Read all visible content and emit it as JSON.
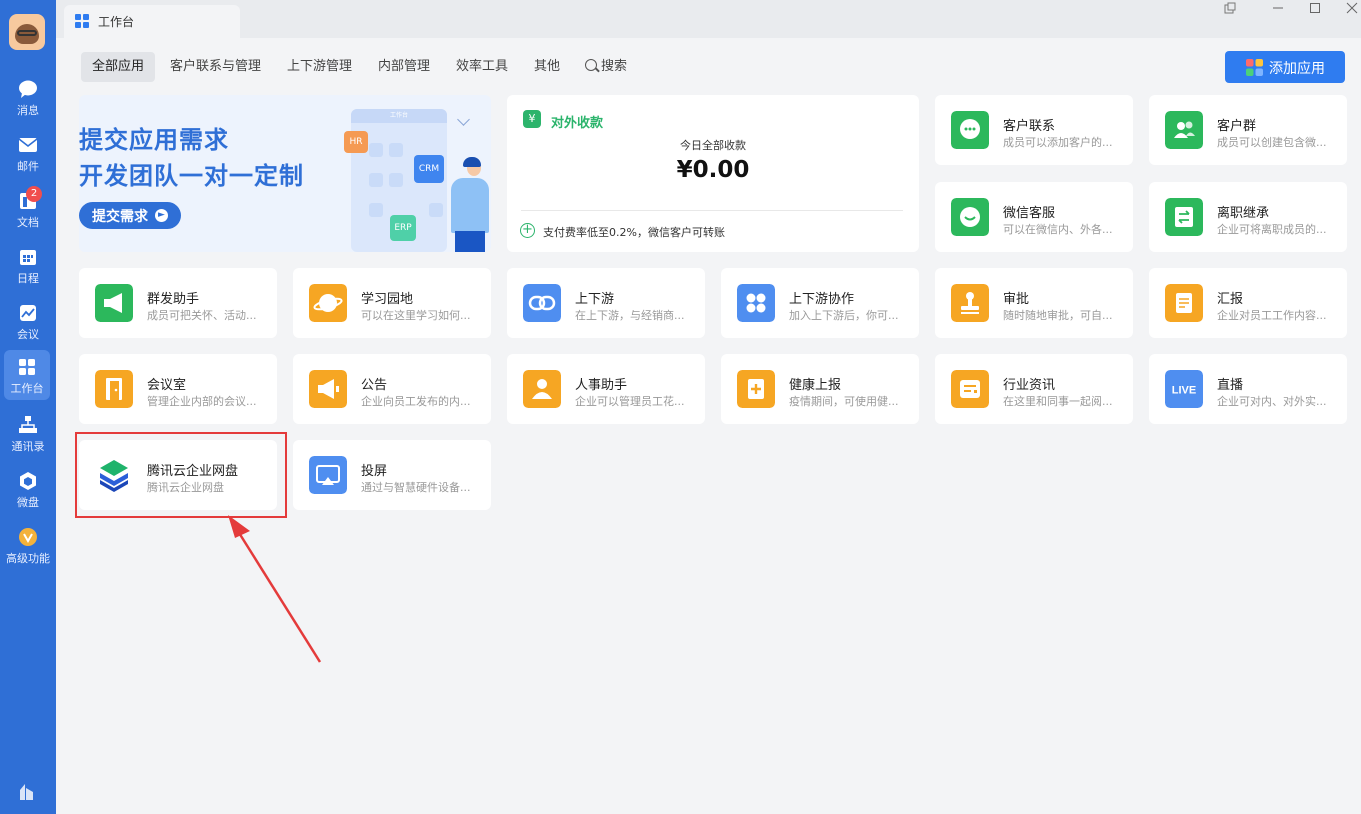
{
  "sidebar": {
    "items": [
      {
        "label": "消息",
        "icon": "message-icon"
      },
      {
        "label": "邮件",
        "icon": "mail-icon"
      },
      {
        "label": "文档",
        "icon": "document-icon",
        "badge": "2"
      },
      {
        "label": "日程",
        "icon": "calendar-icon"
      },
      {
        "label": "会议",
        "icon": "meeting-icon"
      },
      {
        "label": "工作台",
        "icon": "workbench-icon",
        "active": true
      },
      {
        "label": "通讯录",
        "icon": "contacts-icon"
      },
      {
        "label": "微盘",
        "icon": "weipan-icon"
      },
      {
        "label": "高级功能",
        "icon": "premium-icon"
      }
    ]
  },
  "window": {
    "tab_title": "工作台"
  },
  "categories": [
    "全部应用",
    "客户联系与管理",
    "上下游管理",
    "内部管理",
    "效率工具",
    "其他",
    "搜索"
  ],
  "add_app_label": "添加应用",
  "banner": {
    "line1": "提交应用需求",
    "line2": "开发团队一对一定制",
    "button": "提交需求",
    "chips": [
      "HR",
      "CRM",
      "ERP"
    ],
    "board_title": "工作台"
  },
  "income": {
    "title": "对外收款",
    "subtitle": "今日全部收款",
    "amount": "¥0.00",
    "note": "支付费率低至0.2%，微信客户可转账"
  },
  "apps": [
    {
      "name": "客户联系",
      "desc": "成员可以添加客户的...",
      "icon": "chat-bubble-icon",
      "color": "#2cb85c"
    },
    {
      "name": "客户群",
      "desc": "成员可以创建包含微...",
      "icon": "group-icon",
      "color": "#2cb85c"
    },
    {
      "name": "微信客服",
      "desc": "可以在微信内、外各...",
      "icon": "customer-service-icon",
      "color": "#2cb85c"
    },
    {
      "name": "离职继承",
      "desc": "企业可将离职成员的...",
      "icon": "transfer-icon",
      "color": "#2cb85c"
    },
    {
      "name": "群发助手",
      "desc": "成员可把关怀、活动...",
      "icon": "megaphone-icon",
      "color": "#2cb85c"
    },
    {
      "name": "学习园地",
      "desc": "可以在这里学习如何...",
      "icon": "planet-icon",
      "color": "#f6a623"
    },
    {
      "name": "上下游",
      "desc": "在上下游，与经销商...",
      "icon": "link-icon",
      "color": "#4f8ef0"
    },
    {
      "name": "上下游协作",
      "desc": "加入上下游后，你可...",
      "icon": "collab-icon",
      "color": "#4f8ef0"
    },
    {
      "name": "审批",
      "desc": "随时随地审批，可自...",
      "icon": "stamp-icon",
      "color": "#f6a623"
    },
    {
      "name": "汇报",
      "desc": "企业对员工工作内容...",
      "icon": "report-icon",
      "color": "#f6a623"
    },
    {
      "name": "会议室",
      "desc": "管理企业内部的会议...",
      "icon": "door-icon",
      "color": "#f6a623"
    },
    {
      "name": "公告",
      "desc": "企业向员工发布的内...",
      "icon": "announcement-icon",
      "color": "#f6a623"
    },
    {
      "name": "人事助手",
      "desc": "企业可以管理员工花...",
      "icon": "hr-person-icon",
      "color": "#f6a623"
    },
    {
      "name": "健康上报",
      "desc": "疫情期间，可使用健...",
      "icon": "health-icon",
      "color": "#f6a623"
    },
    {
      "name": "行业资讯",
      "desc": "在这里和同事一起阅...",
      "icon": "news-icon",
      "color": "#f6a623"
    },
    {
      "name": "直播",
      "desc": "企业可对内、对外实...",
      "icon": "live-icon",
      "color": "#4f8ef0",
      "icon_text": "LIVE"
    },
    {
      "name": "腾讯云企业网盘",
      "desc": "腾讯云企业网盘",
      "icon": "tencent-cloud-disk-icon",
      "color": "#ffffff"
    },
    {
      "name": "投屏",
      "desc": "通过与智慧硬件设备...",
      "icon": "screen-cast-icon",
      "color": "#4f8ef0"
    }
  ]
}
